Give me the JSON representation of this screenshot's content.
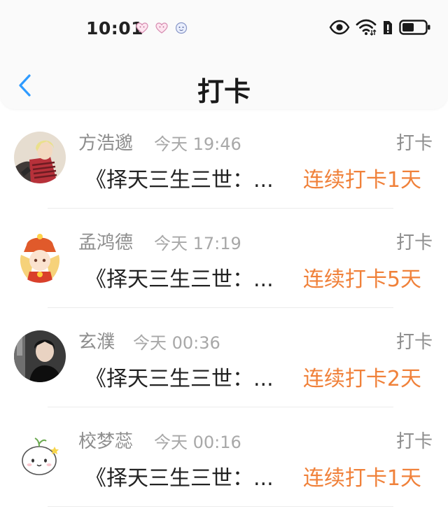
{
  "status_bar": {
    "time": "10:01"
  },
  "nav": {
    "title": "打卡"
  },
  "list": {
    "items": [
      {
        "name": "方浩邈",
        "time": "今天 19:46",
        "action": "打卡",
        "book": "《择天三生三世：...",
        "streak": "连续打卡1天"
      },
      {
        "name": "孟鸿德",
        "time": "今天 17:19",
        "action": "打卡",
        "book": "《择天三生三世：...",
        "streak": "连续打卡5天"
      },
      {
        "name": "玄濮",
        "time": "今天 00:36",
        "action": "打卡",
        "book": "《择天三生三世：...",
        "streak": "连续打卡2天"
      },
      {
        "name": "校梦蕊",
        "time": "今天 00:16",
        "action": "打卡",
        "book": "《择天三生三世：...",
        "streak": "连续打卡1天"
      }
    ]
  },
  "colors": {
    "accent_back": "#2f9bff",
    "streak": "#f0813a",
    "name": "#8d8d8d",
    "time": "#a8a8a8"
  }
}
